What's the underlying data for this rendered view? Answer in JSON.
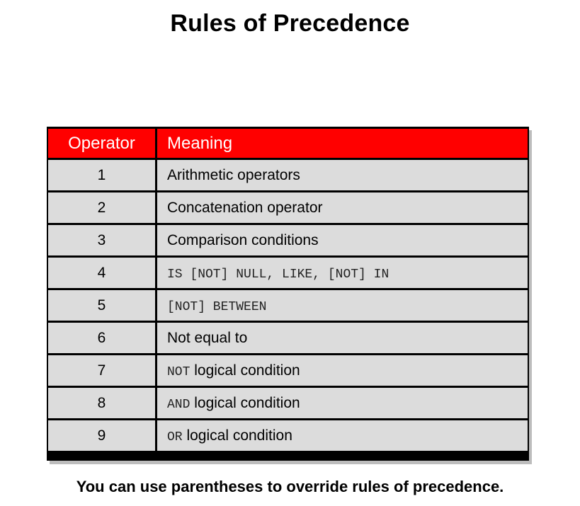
{
  "title": "Rules of Precedence",
  "table": {
    "header": {
      "operator": "Operator",
      "meaning": "Meaning"
    },
    "rows": [
      {
        "num": "1",
        "code": "",
        "text": "Arithmetic operators"
      },
      {
        "num": "2",
        "code": "",
        "text": "Concatenation operator"
      },
      {
        "num": "3",
        "code": "",
        "text": "Comparison conditions"
      },
      {
        "num": "4",
        "code": "IS [NOT] NULL, LIKE, [NOT] IN",
        "text": ""
      },
      {
        "num": "5",
        "code": "[NOT] BETWEEN",
        "text": ""
      },
      {
        "num": "6",
        "code": "",
        "text": "Not equal to"
      },
      {
        "num": "7",
        "code": "NOT",
        "text": " logical condition"
      },
      {
        "num": "8",
        "code": "AND",
        "text": " logical condition"
      },
      {
        "num": "9",
        "code": "OR",
        "text": " logical condition"
      }
    ]
  },
  "footer": "You can use parentheses to override rules of precedence.",
  "colors": {
    "header_bg": "#ff0000",
    "header_text": "#ffffff",
    "cell_bg": "#dcdcdc",
    "border": "#000000"
  }
}
